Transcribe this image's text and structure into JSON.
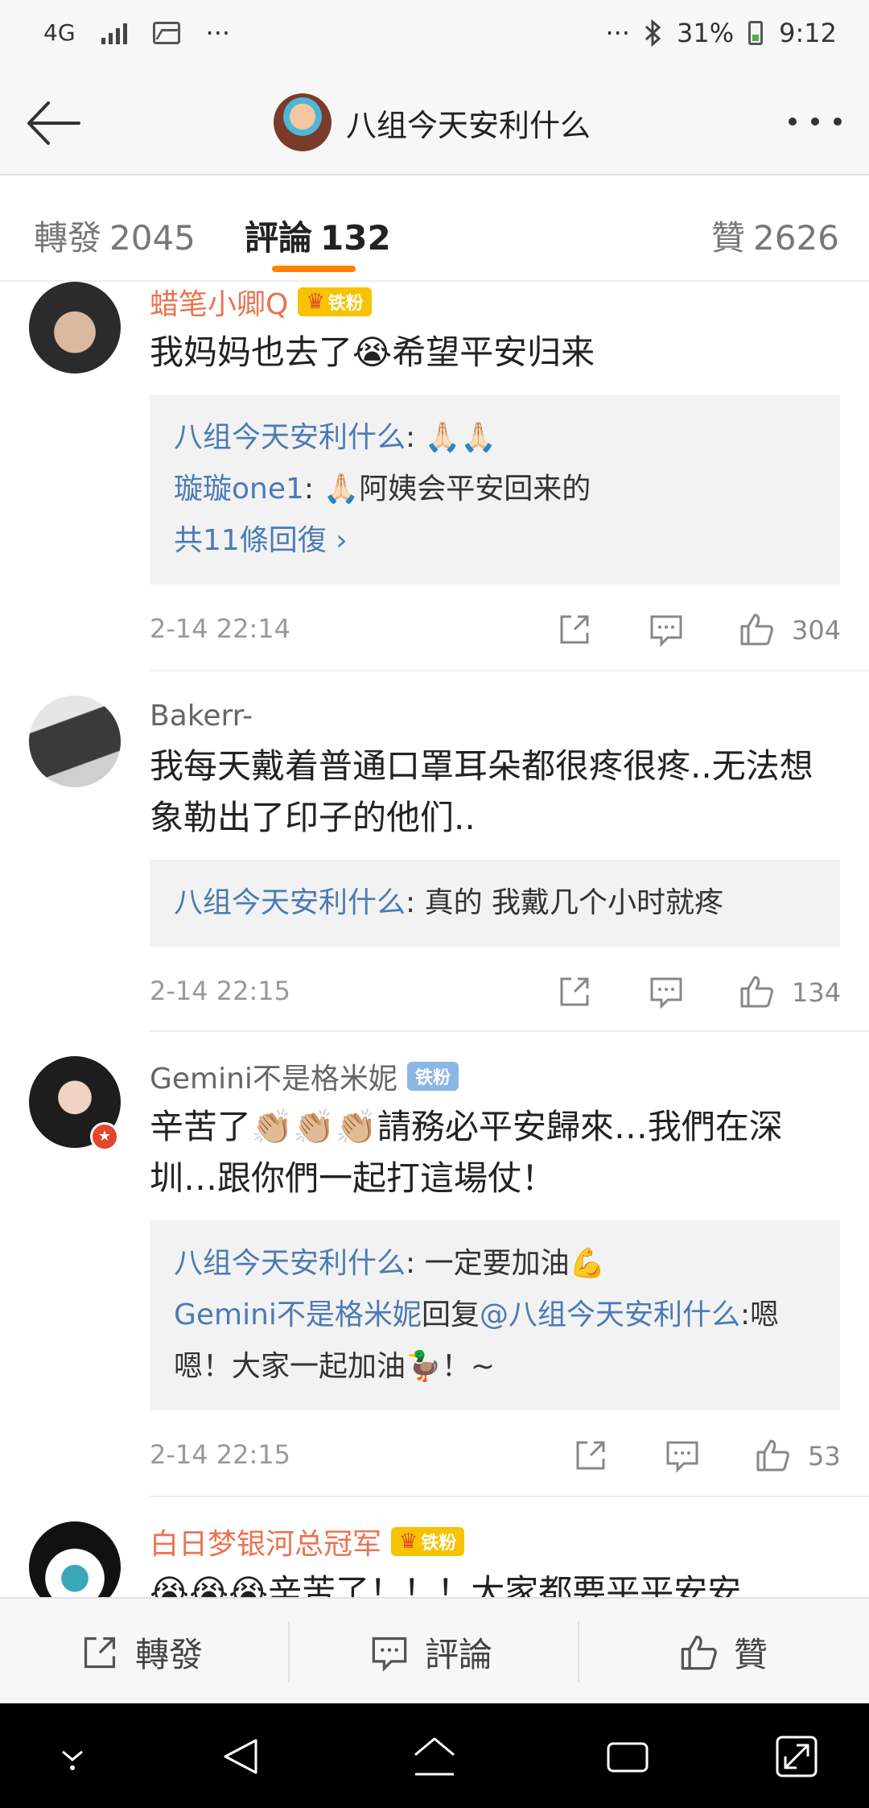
{
  "status_bar": {
    "network": "4G",
    "dots_left": "···",
    "dots_right": "···",
    "battery": "31%",
    "time": "9:12"
  },
  "header": {
    "title": "八组今天安利什么"
  },
  "tabs": [
    {
      "label": "轉發",
      "count": "2045"
    },
    {
      "label": "評論",
      "count": "132"
    },
    {
      "label": "贊",
      "count": "2626"
    }
  ],
  "comments": [
    {
      "user": "蜡笔小卿Q",
      "badge": "铁粉",
      "text": "我妈妈也去了😭希望平安归来",
      "replies": [
        {
          "user": "八组今天安利什么",
          "sep": ": ",
          "text": "🙏🏻🙏🏻"
        },
        {
          "user": "璇璇one1",
          "sep": ": ",
          "text": "🙏🏻阿姨会平安回来的"
        }
      ],
      "more_replies": "共11條回復 ›",
      "time": "2-14 22:14",
      "likes": "304"
    },
    {
      "user": "Bakerr-",
      "text": "我每天戴着普通口罩耳朵都很疼很疼..无法想象勒出了印子的他们..",
      "replies": [
        {
          "user": "八组今天安利什么",
          "sep": ": ",
          "text": "真的 我戴几个小时就疼"
        }
      ],
      "time": "2-14 22:15",
      "likes": "134"
    },
    {
      "user": "Gemini不是格米妮",
      "badge": "铁粉",
      "text": "辛苦了👏🏼👏🏼👏🏼請務必平安歸來…我們在深圳…跟你們一起打這場仗！",
      "replies": [
        {
          "user": "八组今天安利什么",
          "sep": ": ",
          "text": "一定要加油💪"
        },
        {
          "user": "Gemini不是格米妮",
          "mid": "回复",
          "mention": "@八组今天安利什么",
          "sep": ":",
          "text": "嗯嗯！大家一起加油🦆！~"
        }
      ],
      "time": "2-14 22:15",
      "likes": "53"
    },
    {
      "user": "白日梦银河总冠军",
      "badge": "铁粉",
      "text": "😭😭😭辛苦了！！！大家都要平平安安"
    }
  ],
  "actionbar": {
    "repost": "轉發",
    "comment": "評論",
    "like": "贊"
  },
  "colors": {
    "accent": "#ff8200",
    "username": "#eb7350",
    "link": "#4b7bb4"
  }
}
